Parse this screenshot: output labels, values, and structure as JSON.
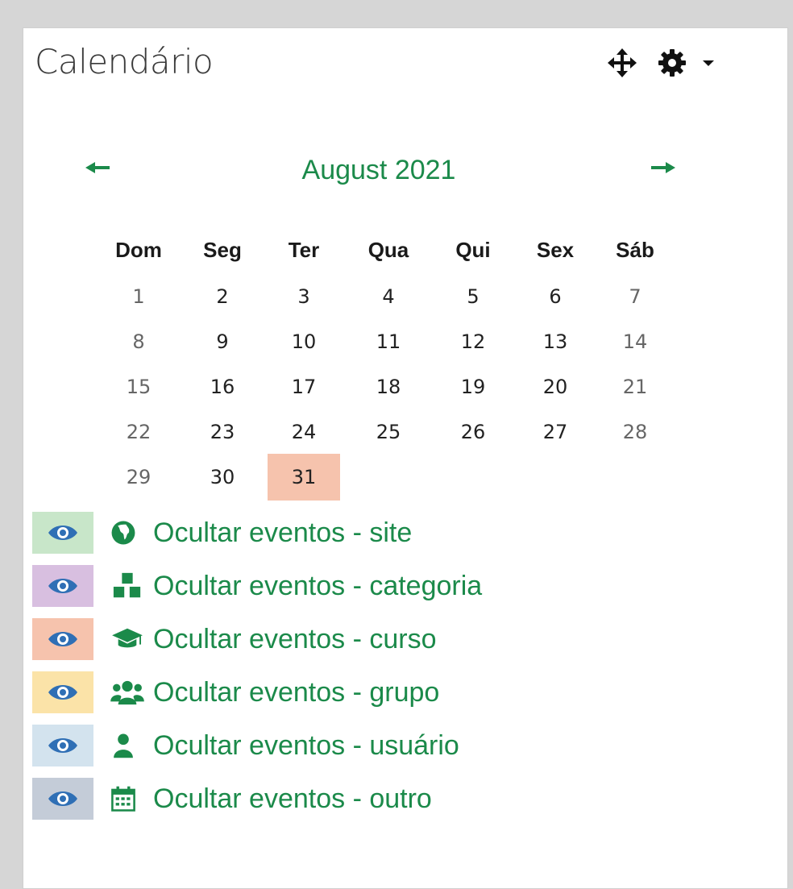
{
  "header": {
    "title": "Calendário"
  },
  "calendar": {
    "month_label": "August 2021",
    "weekdays": [
      "Dom",
      "Seg",
      "Ter",
      "Qua",
      "Qui",
      "Sex",
      "Sáb"
    ],
    "weeks": [
      [
        "1",
        "2",
        "3",
        "4",
        "5",
        "6",
        "7"
      ],
      [
        "8",
        "9",
        "10",
        "11",
        "12",
        "13",
        "14"
      ],
      [
        "15",
        "16",
        "17",
        "18",
        "19",
        "20",
        "21"
      ],
      [
        "22",
        "23",
        "24",
        "25",
        "26",
        "27",
        "28"
      ],
      [
        "29",
        "30",
        "31",
        "",
        "",
        "",
        ""
      ]
    ],
    "today": "31",
    "today_color": "#f6c3ad",
    "accent_color": "#1b8a4a"
  },
  "events": [
    {
      "label": "Ocultar eventos - site",
      "icon": "globe-icon",
      "bg": "#c8e6c9"
    },
    {
      "label": "Ocultar eventos - categoria",
      "icon": "cubes-icon",
      "bg": "#d8bfe0"
    },
    {
      "label": "Ocultar eventos - curso",
      "icon": "graduation-cap-icon",
      "bg": "#f6c3ad"
    },
    {
      "label": "Ocultar eventos - grupo",
      "icon": "users-icon",
      "bg": "#fbe3a8"
    },
    {
      "label": "Ocultar eventos - usuário",
      "icon": "user-icon",
      "bg": "#d3e3ee"
    },
    {
      "label": "Ocultar eventos - outro",
      "icon": "calendar-icon",
      "bg": "#c4ccd8"
    }
  ]
}
